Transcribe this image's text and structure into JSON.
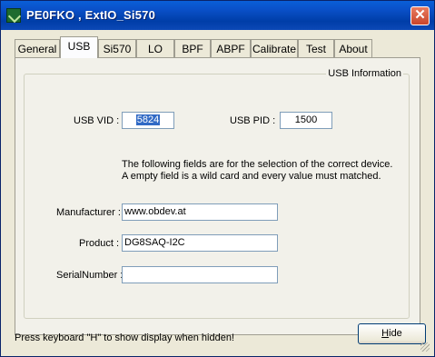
{
  "window": {
    "title": "PE0FKO , ExtIO_Si570"
  },
  "tabs": [
    {
      "label": "General"
    },
    {
      "label": "USB"
    },
    {
      "label": "Si570"
    },
    {
      "label": "LO"
    },
    {
      "label": "BPF"
    },
    {
      "label": "ABPF"
    },
    {
      "label": "Calibrate"
    },
    {
      "label": "Test"
    },
    {
      "label": "About"
    }
  ],
  "usb": {
    "group_title": "USB Information",
    "vid_label": "USB VID :",
    "vid_value": "5824",
    "pid_label": "USB PID :",
    "pid_value": "1500",
    "info_line1": "The following fields are for the selection of the correct device.",
    "info_line2": "A empty field is a wild card and every value must matched.",
    "manufacturer_label": "Manufacturer :",
    "manufacturer_value": "www.obdev.at",
    "product_label": "Product :",
    "product_value": "DG8SAQ-I2C",
    "serial_label": "SerialNumber :",
    "serial_value": ""
  },
  "footer": {
    "status": "Press keyboard \"H\" to show display when hidden!",
    "hide_label_underlined": "H",
    "hide_label_rest": "ide"
  },
  "colors": {
    "titlebar": "#0a50c8",
    "close": "#c9452b",
    "selection": "#316ac5"
  }
}
